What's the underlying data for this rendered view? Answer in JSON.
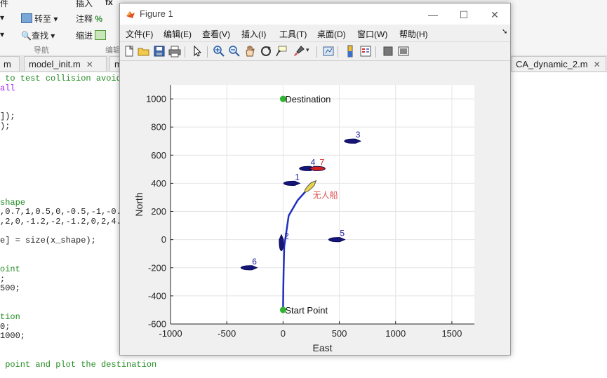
{
  "ribbon": {
    "top_partial": [
      "件",
      "插入",
      "fx"
    ],
    "row1": [
      "转至",
      "注释"
    ],
    "row2": [
      "查找",
      "缩进"
    ],
    "sections": [
      "导航",
      "编辑"
    ]
  },
  "editor_tabs": [
    {
      "label": "m"
    },
    {
      "label": "model_init.m"
    },
    {
      "label": "m"
    },
    {
      "label": "CA_dynamic_2.m"
    }
  ],
  "code_lines": [
    {
      "text": " to test collision avoid",
      "cls": "cm"
    },
    {
      "text": "all",
      "cls": "kw"
    },
    {
      "text": "",
      "cls": ""
    },
    {
      "text": "",
      "cls": ""
    },
    {
      "text": "]);",
      "cls": ""
    },
    {
      "text": ");",
      "cls": ""
    },
    {
      "text": "",
      "cls": ""
    },
    {
      "text": "",
      "cls": ""
    },
    {
      "text": "",
      "cls": ""
    },
    {
      "text": "",
      "cls": ""
    },
    {
      "text": "",
      "cls": ""
    },
    {
      "text": "",
      "cls": ""
    },
    {
      "text": "",
      "cls": ""
    },
    {
      "text": "shape",
      "cls": "cm"
    },
    {
      "text": ",0.7,1,0.5,0,-0.5,-1,-0.",
      "cls": ""
    },
    {
      "text": ",2,0,-1.2,-2,-1.2,0,2,4.",
      "cls": ""
    },
    {
      "text": "",
      "cls": ""
    },
    {
      "text": "e] = size(x_shape);",
      "cls": ""
    },
    {
      "text": "",
      "cls": ""
    },
    {
      "text": "",
      "cls": ""
    },
    {
      "text": "oint",
      "cls": "cm"
    },
    {
      "text": ";",
      "cls": ""
    },
    {
      "text": "500;",
      "cls": ""
    },
    {
      "text": "",
      "cls": ""
    },
    {
      "text": "",
      "cls": ""
    },
    {
      "text": "tion",
      "cls": "cm"
    },
    {
      "text": "0;",
      "cls": ""
    },
    {
      "text": "1000;",
      "cls": ""
    },
    {
      "text": "",
      "cls": ""
    },
    {
      "text": "",
      "cls": ""
    },
    {
      "text": " point and plot the destination",
      "cls": "cm"
    }
  ],
  "figure": {
    "title": "Figure 1",
    "controls": {
      "minimize": "—",
      "maximize": "☐",
      "close": "✕"
    },
    "menus": [
      "文件(F)",
      "编辑(E)",
      "查看(V)",
      "插入(I)",
      "工具(T)",
      "桌面(D)",
      "窗口(W)",
      "帮助(H)"
    ],
    "menu_arrow": "➘",
    "toolbar_icons": [
      "new-figure-icon",
      "open-icon",
      "save-icon",
      "print-icon",
      "pointer-icon",
      "zoom-in-icon",
      "zoom-out-icon",
      "pan-icon",
      "rotate-icon",
      "data-cursor-icon",
      "brush-icon",
      "link-icon",
      "colorbar-icon",
      "legend-icon",
      "hide-plot-tools-icon",
      "show-plot-tools-icon"
    ]
  },
  "chart_data": {
    "type": "scatter",
    "title": "",
    "xlabel": "East",
    "ylabel": "North",
    "xlim": [
      -1000,
      1700
    ],
    "ylim": [
      -600,
      1100
    ],
    "xticks": [
      -1000,
      -500,
      0,
      500,
      1000,
      1500
    ],
    "yticks": [
      -600,
      -400,
      -200,
      0,
      200,
      400,
      600,
      800,
      1000
    ],
    "grid": true,
    "colors": {
      "path": "#1f2fbf",
      "ship": "#15157a",
      "own_ship": "#e8d44a",
      "ship7": "#d62020",
      "marker": "#2fb52f",
      "own_label": "#e05050",
      "label": "#1a1aa0"
    },
    "points": [
      {
        "label": "Destination",
        "x": 0,
        "y": 1000
      },
      {
        "label": "Start Point",
        "x": 0,
        "y": -500
      }
    ],
    "path": {
      "x": [
        0,
        2,
        5,
        10,
        50,
        130,
        220,
        250
      ],
      "y": [
        -500,
        -350,
        -220,
        -50,
        170,
        280,
        360,
        385
      ]
    },
    "own_ship": {
      "label": "无人船",
      "x": 245,
      "y": 380,
      "heading_deg": 45
    },
    "ships": [
      {
        "label": "1",
        "x": 80,
        "y": 400,
        "heading_deg": 0
      },
      {
        "label": "2",
        "x": -15,
        "y": -20,
        "heading_deg": 90
      },
      {
        "label": "3",
        "x": 620,
        "y": 700,
        "heading_deg": 0
      },
      {
        "label": "4",
        "x": 220,
        "y": 505,
        "heading_deg": 0
      },
      {
        "label": "5",
        "x": 480,
        "y": 0,
        "heading_deg": 0
      },
      {
        "label": "6",
        "x": -300,
        "y": -200,
        "heading_deg": 0
      },
      {
        "label": "7",
        "x": 300,
        "y": 505,
        "heading_deg": 180
      }
    ]
  }
}
